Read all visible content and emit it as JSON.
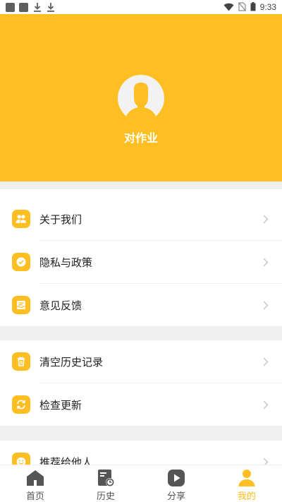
{
  "status_bar": {
    "time": "9:33"
  },
  "profile": {
    "name": "对作业"
  },
  "menu_groups": [
    {
      "items": [
        {
          "label": "关于我们",
          "icon": "users-icon"
        },
        {
          "label": "隐私与政策",
          "icon": "shield-check-icon"
        },
        {
          "label": "意见反馈",
          "icon": "feedback-icon"
        }
      ]
    },
    {
      "items": [
        {
          "label": "清空历史记录",
          "icon": "trash-icon"
        },
        {
          "label": "检查更新",
          "icon": "refresh-icon"
        }
      ]
    },
    {
      "items": [
        {
          "label": "推荐给他人",
          "icon": "smile-icon"
        }
      ]
    }
  ],
  "tabbar": {
    "items": [
      {
        "label": "首页",
        "icon": "home-icon"
      },
      {
        "label": "历史",
        "icon": "history-icon"
      },
      {
        "label": "分享",
        "icon": "play-share-icon"
      },
      {
        "label": "我的",
        "icon": "person-icon",
        "active": true
      }
    ]
  },
  "colors": {
    "accent": "#FFBE22",
    "background": "#efefef",
    "tab_inactive": "#555555"
  }
}
